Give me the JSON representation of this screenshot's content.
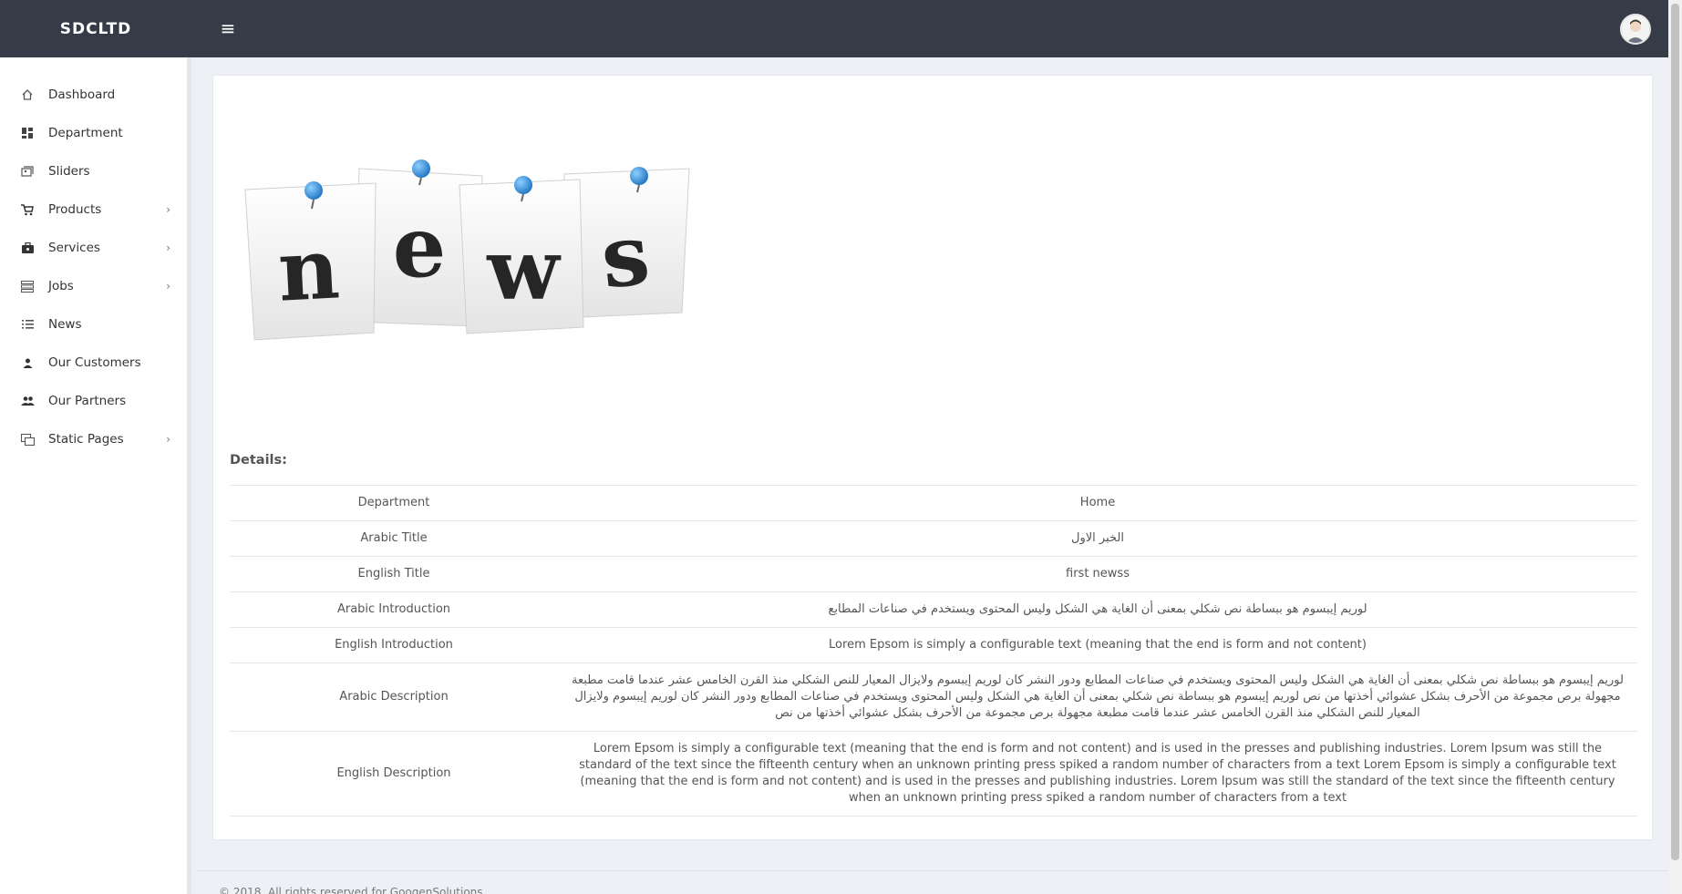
{
  "header": {
    "brand": "SDCLTD",
    "menu_icon": "≡"
  },
  "sidebar": {
    "items": [
      {
        "label": "Dashboard",
        "icon": "home-icon",
        "has_submenu": false
      },
      {
        "label": "Department",
        "icon": "grid-icon",
        "has_submenu": false
      },
      {
        "label": "Sliders",
        "icon": "images-icon",
        "has_submenu": false
      },
      {
        "label": "Products",
        "icon": "cart-icon",
        "has_submenu": true
      },
      {
        "label": "Services",
        "icon": "briefcase-icon",
        "has_submenu": true
      },
      {
        "label": "Jobs",
        "icon": "list-detail-icon",
        "has_submenu": true
      },
      {
        "label": "News",
        "icon": "list-icon",
        "has_submenu": false
      },
      {
        "label": "Our Customers",
        "icon": "person-icon",
        "has_submenu": false
      },
      {
        "label": "Our Partners",
        "icon": "people-icon",
        "has_submenu": false
      },
      {
        "label": "Static Pages",
        "icon": "pages-icon",
        "has_submenu": true
      }
    ]
  },
  "image": {
    "letters": [
      "n",
      "e",
      "w",
      "s"
    ]
  },
  "details": {
    "title": "Details:",
    "rows": [
      {
        "label": "Department",
        "value": "Home",
        "rtl": false
      },
      {
        "label": "Arabic Title",
        "value": "الخبر الاول",
        "rtl": true
      },
      {
        "label": "English Title",
        "value": "first newss",
        "rtl": false
      },
      {
        "label": "Arabic Introduction",
        "value": "لوريم إيبسوم هو ببساطة نص شكلي بمعنى أن الغاية هي الشكل وليس المحتوى ويستخدم في صناعات المطابع",
        "rtl": true
      },
      {
        "label": "English Introduction",
        "value": "Lorem Epsom is simply a configurable text (meaning that the end is form and not content)",
        "rtl": false
      },
      {
        "label": "Arabic Description",
        "value": "لوريم إيبسوم هو ببساطة نص شكلي بمعنى أن الغاية هي الشكل وليس المحتوى ويستخدم في صناعات المطابع ودور النشر كان لوريم إيبسوم ولايزال المعيار للنص الشكلي منذ القرن الخامس عشر عندما قامت مطبعة مجهولة برص مجموعة من الأحرف بشكل عشوائي أخذتها من نص لوريم إيبسوم هو ببساطة نص شكلي بمعنى أن الغاية هي الشكل وليس المحتوى ويستخدم في صناعات المطابع ودور النشر كان لوريم إيبسوم ولايزال المعيار للنص الشكلي منذ القرن الخامس عشر عندما قامت مطبعة مجهولة برص مجموعة من الأحرف بشكل عشوائي أخذتها من نص",
        "rtl": true
      },
      {
        "label": "English Description",
        "value": "Lorem Epsom is simply a configurable text (meaning that the end is form and not content) and is used in the presses and publishing industries. Lorem Ipsum was still the standard of the text since the fifteenth century when an unknown printing press spiked a random number of characters from a text Lorem Epsom is simply a configurable text (meaning that the end is form and not content) and is used in the presses and publishing industries. Lorem Ipsum was still the standard of the text since the fifteenth century when an unknown printing press spiked a random number of characters from a text",
        "rtl": false
      }
    ]
  },
  "footer": {
    "text": "© 2018. All rights reserved for GoogenSolutions"
  }
}
